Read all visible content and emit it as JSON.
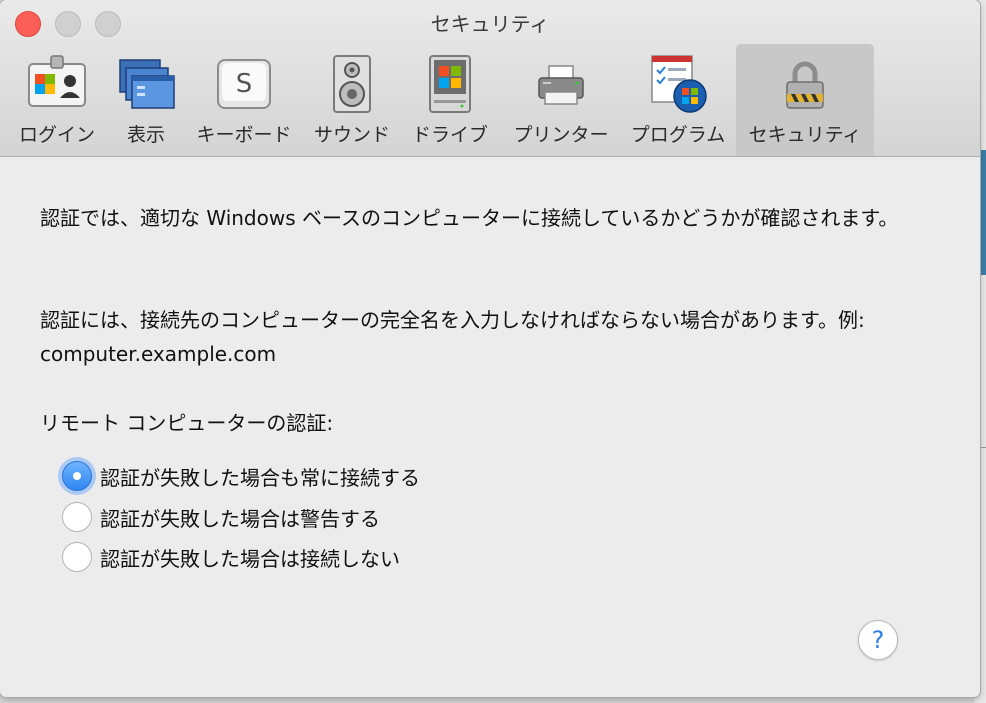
{
  "window": {
    "title": "セキュリティ"
  },
  "toolbar": {
    "tabs": [
      {
        "label": "ログイン",
        "icon": "login-id-card-icon"
      },
      {
        "label": "表示",
        "icon": "display-windows-icon"
      },
      {
        "label": "キーボード",
        "icon": "keyboard-key-icon"
      },
      {
        "label": "サウンド",
        "icon": "speaker-icon"
      },
      {
        "label": "ドライブ",
        "icon": "drive-icon"
      },
      {
        "label": "プリンター",
        "icon": "printer-icon"
      },
      {
        "label": "プログラム",
        "icon": "programs-icon"
      },
      {
        "label": "セキュリティ",
        "icon": "padlock-icon",
        "selected": true
      }
    ],
    "keyboard_glyph": "S"
  },
  "content": {
    "para1": "認証では、適切な Windows ベースのコンピューターに接続しているかどうかが確認されます。",
    "para2": "認証には、接続先のコンピューターの完全名を入力しなければならない場合があります。例: computer.example.com",
    "section_label": "リモート コンピューターの認証:",
    "options": [
      {
        "label": "認証が失敗した場合も常に接続する",
        "selected": true
      },
      {
        "label": "認証が失敗した場合は警告する",
        "selected": false
      },
      {
        "label": "認証が失敗した場合は接続しない",
        "selected": false
      }
    ],
    "help_glyph": "?"
  },
  "colors": {
    "accent": "#2f86f3",
    "close_button": "#fc5f57",
    "window_bg": "#ececec"
  }
}
